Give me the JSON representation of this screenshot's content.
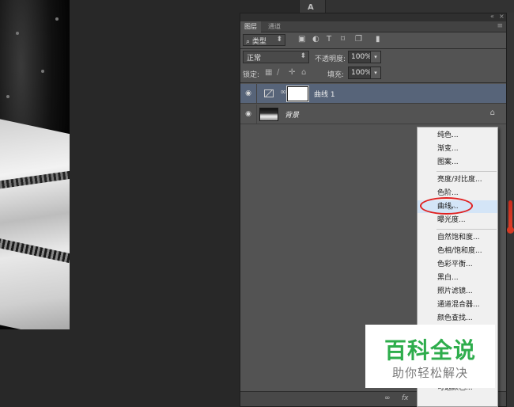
{
  "top_tool": {
    "glyph": "A"
  },
  "panel": {
    "header_controls": [
      "«",
      "×"
    ],
    "menu_glyph": "≡",
    "tabs": [
      {
        "label": "图层",
        "active": true
      },
      {
        "label": "通道",
        "active": false
      }
    ],
    "filter": {
      "label": "⌕ 类型",
      "arrow": "⬍",
      "icons": [
        "▣",
        "◐",
        "T",
        "⌑",
        "❐",
        "▮"
      ]
    },
    "blend": {
      "mode": "正常",
      "arrow": "⬍",
      "opacity_label": "不透明度:",
      "opacity_value": "100%",
      "fill_label": "填充:",
      "fill_value": "100%",
      "stepper": "▾"
    },
    "lock": {
      "label": "锁定:",
      "icons": [
        "▦",
        "∕",
        "✛",
        "⌂"
      ]
    },
    "layers": [
      {
        "name": "曲线 1",
        "selected": true,
        "visible_glyph": "◉",
        "chain": "∞"
      },
      {
        "name": "背景",
        "selected": false,
        "visible_glyph": "◉",
        "lock": "⌂"
      }
    ],
    "footer_icons": [
      "∞",
      "fx",
      "▣",
      "◐",
      "□",
      "■",
      "␡"
    ]
  },
  "menu": {
    "groups": [
      [
        "纯色...",
        "渐变...",
        "图案..."
      ],
      [
        "亮度/对比度...",
        "色阶...",
        "曲线...",
        "曝光度..."
      ],
      [
        "自然饱和度...",
        "色相/饱和度...",
        "色彩平衡...",
        "黑白...",
        "照片滤镜...",
        "通道混合器...",
        "颜色查找..."
      ]
    ],
    "hovered": "曲线...",
    "partial_bottom": "可选颜色..."
  },
  "watermark": {
    "title": "百科全说",
    "subtitle": "助你轻松解决"
  },
  "colors": {
    "accent_selection": "#576479",
    "highlight_red": "#e02020",
    "watermark_green": "#2ead4c"
  }
}
